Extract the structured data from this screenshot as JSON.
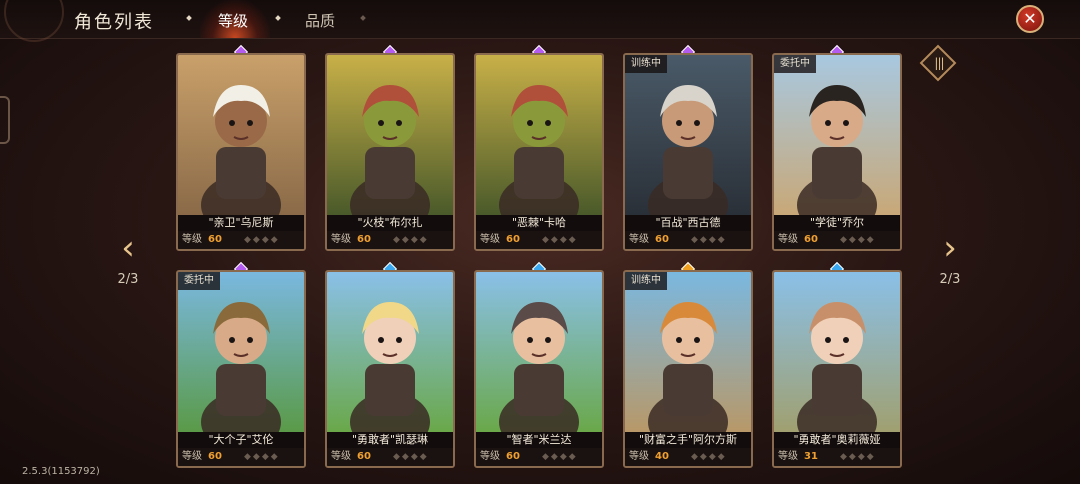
{
  "header": {
    "title": "角色列表",
    "tabs": [
      {
        "label": "等级",
        "active": true
      },
      {
        "label": "品质",
        "active": false
      }
    ]
  },
  "nav": {
    "left_page": "2/3",
    "right_page": "2/3"
  },
  "version": "2.5.3(1153792)",
  "colors": {
    "accent": "#f0a030",
    "purple_gem": "#b45cf0",
    "blue_gem": "#3aa8f0",
    "orange_gem": "#f0a020"
  },
  "cards": [
    {
      "name": "\"亲卫\"乌尼斯",
      "level_label": "等级",
      "level": "60",
      "status": "",
      "gem": "purple",
      "skin": "#9a6a48",
      "hair": "#f2efe6",
      "bg_top": "#c9a06a",
      "bg_bottom": "#8a6a48"
    },
    {
      "name": "\"火枝\"布尔扎",
      "level_label": "等级",
      "level": "60",
      "status": "",
      "gem": "purple",
      "skin": "#8a9a3a",
      "hair": "#b0503a",
      "bg_top": "#c8b048",
      "bg_bottom": "#4a5a2a"
    },
    {
      "name": "\"恶棘\"卡哈",
      "level_label": "等级",
      "level": "60",
      "status": "",
      "gem": "purple",
      "skin": "#8a9a3a",
      "hair": "#b0503a",
      "bg_top": "#c8b048",
      "bg_bottom": "#4a5a2a"
    },
    {
      "name": "\"百战\"西古德",
      "level_label": "等级",
      "level": "60",
      "status": "训练中",
      "gem": "purple",
      "skin": "#c89a78",
      "hair": "#d8d4cc",
      "bg_top": "#4a5a68",
      "bg_bottom": "#2a3038"
    },
    {
      "name": "\"学徒\"乔尔",
      "level_label": "等级",
      "level": "60",
      "status": "委托中",
      "gem": "purple",
      "skin": "#d8aa88",
      "hair": "#2a2420",
      "bg_top": "#a8c8e0",
      "bg_bottom": "#c8a878"
    },
    {
      "name": "\"大个子\"艾伦",
      "level_label": "等级",
      "level": "60",
      "status": "委托中",
      "gem": "purple",
      "skin": "#d8aa88",
      "hair": "#8a6a3a",
      "bg_top": "#7ab8e0",
      "bg_bottom": "#5a9a48"
    },
    {
      "name": "\"勇敢者\"凯瑟琳",
      "level_label": "等级",
      "level": "60",
      "status": "",
      "gem": "blue",
      "skin": "#f0d0b8",
      "hair": "#f0d888",
      "bg_top": "#8ac0e8",
      "bg_bottom": "#6aa84a"
    },
    {
      "name": "\"智者\"米兰达",
      "level_label": "等级",
      "level": "60",
      "status": "",
      "gem": "blue",
      "skin": "#e8c0a0",
      "hair": "#5a4a48",
      "bg_top": "#8ac0e8",
      "bg_bottom": "#6aa84a"
    },
    {
      "name": "\"财富之手\"阿尔方斯",
      "level_label": "等级",
      "level": "40",
      "status": "训练中",
      "gem": "orange",
      "skin": "#e8c0a0",
      "hair": "#d88a3a",
      "bg_top": "#7ab8e0",
      "bg_bottom": "#b89868"
    },
    {
      "name": "\"勇敢者\"奥莉薇娅",
      "level_label": "等级",
      "level": "31",
      "status": "",
      "gem": "blue",
      "skin": "#f0d0b8",
      "hair": "#c8906a",
      "bg_top": "#8ac0e8",
      "bg_bottom": "#a0a070"
    }
  ]
}
